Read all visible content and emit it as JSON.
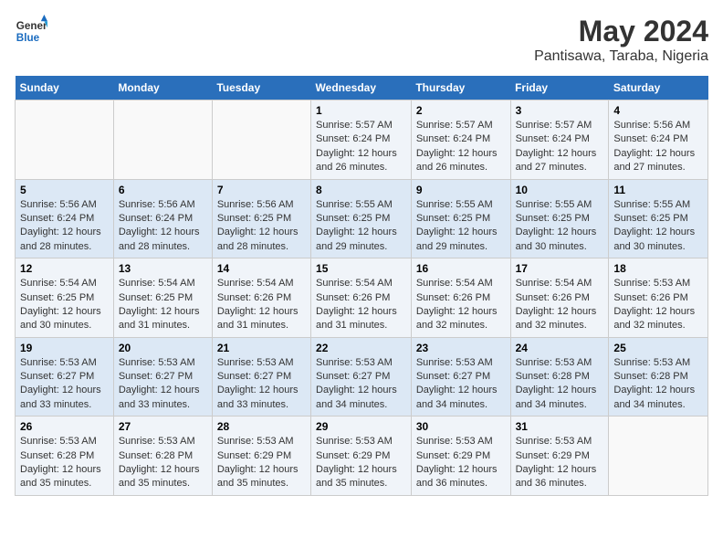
{
  "logo": {
    "line1": "General",
    "line2": "Blue"
  },
  "title": "May 2024",
  "subtitle": "Pantisawa, Taraba, Nigeria",
  "days_header": [
    "Sunday",
    "Monday",
    "Tuesday",
    "Wednesday",
    "Thursday",
    "Friday",
    "Saturday"
  ],
  "weeks": [
    [
      {
        "day": "",
        "sunrise": "",
        "sunset": "",
        "daylight": ""
      },
      {
        "day": "",
        "sunrise": "",
        "sunset": "",
        "daylight": ""
      },
      {
        "day": "",
        "sunrise": "",
        "sunset": "",
        "daylight": ""
      },
      {
        "day": "1",
        "sunrise": "Sunrise: 5:57 AM",
        "sunset": "Sunset: 6:24 PM",
        "daylight": "Daylight: 12 hours and 26 minutes."
      },
      {
        "day": "2",
        "sunrise": "Sunrise: 5:57 AM",
        "sunset": "Sunset: 6:24 PM",
        "daylight": "Daylight: 12 hours and 26 minutes."
      },
      {
        "day": "3",
        "sunrise": "Sunrise: 5:57 AM",
        "sunset": "Sunset: 6:24 PM",
        "daylight": "Daylight: 12 hours and 27 minutes."
      },
      {
        "day": "4",
        "sunrise": "Sunrise: 5:56 AM",
        "sunset": "Sunset: 6:24 PM",
        "daylight": "Daylight: 12 hours and 27 minutes."
      }
    ],
    [
      {
        "day": "5",
        "sunrise": "Sunrise: 5:56 AM",
        "sunset": "Sunset: 6:24 PM",
        "daylight": "Daylight: 12 hours and 28 minutes."
      },
      {
        "day": "6",
        "sunrise": "Sunrise: 5:56 AM",
        "sunset": "Sunset: 6:24 PM",
        "daylight": "Daylight: 12 hours and 28 minutes."
      },
      {
        "day": "7",
        "sunrise": "Sunrise: 5:56 AM",
        "sunset": "Sunset: 6:25 PM",
        "daylight": "Daylight: 12 hours and 28 minutes."
      },
      {
        "day": "8",
        "sunrise": "Sunrise: 5:55 AM",
        "sunset": "Sunset: 6:25 PM",
        "daylight": "Daylight: 12 hours and 29 minutes."
      },
      {
        "day": "9",
        "sunrise": "Sunrise: 5:55 AM",
        "sunset": "Sunset: 6:25 PM",
        "daylight": "Daylight: 12 hours and 29 minutes."
      },
      {
        "day": "10",
        "sunrise": "Sunrise: 5:55 AM",
        "sunset": "Sunset: 6:25 PM",
        "daylight": "Daylight: 12 hours and 30 minutes."
      },
      {
        "day": "11",
        "sunrise": "Sunrise: 5:55 AM",
        "sunset": "Sunset: 6:25 PM",
        "daylight": "Daylight: 12 hours and 30 minutes."
      }
    ],
    [
      {
        "day": "12",
        "sunrise": "Sunrise: 5:54 AM",
        "sunset": "Sunset: 6:25 PM",
        "daylight": "Daylight: 12 hours and 30 minutes."
      },
      {
        "day": "13",
        "sunrise": "Sunrise: 5:54 AM",
        "sunset": "Sunset: 6:25 PM",
        "daylight": "Daylight: 12 hours and 31 minutes."
      },
      {
        "day": "14",
        "sunrise": "Sunrise: 5:54 AM",
        "sunset": "Sunset: 6:26 PM",
        "daylight": "Daylight: 12 hours and 31 minutes."
      },
      {
        "day": "15",
        "sunrise": "Sunrise: 5:54 AM",
        "sunset": "Sunset: 6:26 PM",
        "daylight": "Daylight: 12 hours and 31 minutes."
      },
      {
        "day": "16",
        "sunrise": "Sunrise: 5:54 AM",
        "sunset": "Sunset: 6:26 PM",
        "daylight": "Daylight: 12 hours and 32 minutes."
      },
      {
        "day": "17",
        "sunrise": "Sunrise: 5:54 AM",
        "sunset": "Sunset: 6:26 PM",
        "daylight": "Daylight: 12 hours and 32 minutes."
      },
      {
        "day": "18",
        "sunrise": "Sunrise: 5:53 AM",
        "sunset": "Sunset: 6:26 PM",
        "daylight": "Daylight: 12 hours and 32 minutes."
      }
    ],
    [
      {
        "day": "19",
        "sunrise": "Sunrise: 5:53 AM",
        "sunset": "Sunset: 6:27 PM",
        "daylight": "Daylight: 12 hours and 33 minutes."
      },
      {
        "day": "20",
        "sunrise": "Sunrise: 5:53 AM",
        "sunset": "Sunset: 6:27 PM",
        "daylight": "Daylight: 12 hours and 33 minutes."
      },
      {
        "day": "21",
        "sunrise": "Sunrise: 5:53 AM",
        "sunset": "Sunset: 6:27 PM",
        "daylight": "Daylight: 12 hours and 33 minutes."
      },
      {
        "day": "22",
        "sunrise": "Sunrise: 5:53 AM",
        "sunset": "Sunset: 6:27 PM",
        "daylight": "Daylight: 12 hours and 34 minutes."
      },
      {
        "day": "23",
        "sunrise": "Sunrise: 5:53 AM",
        "sunset": "Sunset: 6:27 PM",
        "daylight": "Daylight: 12 hours and 34 minutes."
      },
      {
        "day": "24",
        "sunrise": "Sunrise: 5:53 AM",
        "sunset": "Sunset: 6:28 PM",
        "daylight": "Daylight: 12 hours and 34 minutes."
      },
      {
        "day": "25",
        "sunrise": "Sunrise: 5:53 AM",
        "sunset": "Sunset: 6:28 PM",
        "daylight": "Daylight: 12 hours and 34 minutes."
      }
    ],
    [
      {
        "day": "26",
        "sunrise": "Sunrise: 5:53 AM",
        "sunset": "Sunset: 6:28 PM",
        "daylight": "Daylight: 12 hours and 35 minutes."
      },
      {
        "day": "27",
        "sunrise": "Sunrise: 5:53 AM",
        "sunset": "Sunset: 6:28 PM",
        "daylight": "Daylight: 12 hours and 35 minutes."
      },
      {
        "day": "28",
        "sunrise": "Sunrise: 5:53 AM",
        "sunset": "Sunset: 6:29 PM",
        "daylight": "Daylight: 12 hours and 35 minutes."
      },
      {
        "day": "29",
        "sunrise": "Sunrise: 5:53 AM",
        "sunset": "Sunset: 6:29 PM",
        "daylight": "Daylight: 12 hours and 35 minutes."
      },
      {
        "day": "30",
        "sunrise": "Sunrise: 5:53 AM",
        "sunset": "Sunset: 6:29 PM",
        "daylight": "Daylight: 12 hours and 36 minutes."
      },
      {
        "day": "31",
        "sunrise": "Sunrise: 5:53 AM",
        "sunset": "Sunset: 6:29 PM",
        "daylight": "Daylight: 12 hours and 36 minutes."
      },
      {
        "day": "",
        "sunrise": "",
        "sunset": "",
        "daylight": ""
      }
    ]
  ]
}
